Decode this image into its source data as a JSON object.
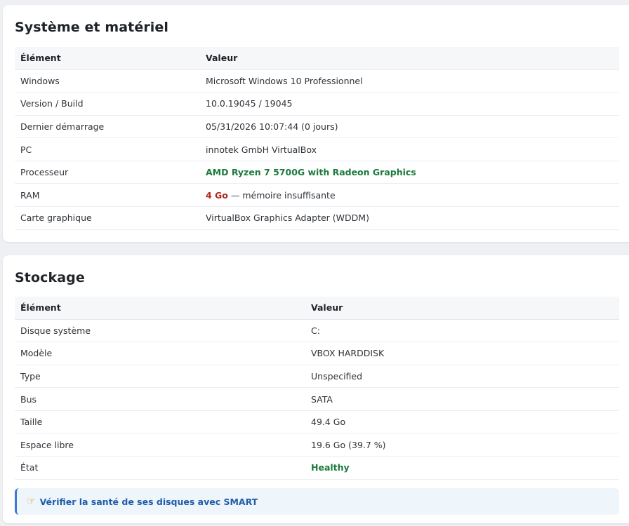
{
  "system": {
    "title": "Système et matériel",
    "headers": [
      "Élément",
      "Valeur"
    ],
    "rows": [
      {
        "label": "Windows",
        "value": "Microsoft Windows 10 Professionnel"
      },
      {
        "label": "Version / Build",
        "value": "10.0.19045 / 19045"
      },
      {
        "label": "Dernier démarrage",
        "value": "05/31/2026 10:07:44 (0 jours)"
      },
      {
        "label": "PC",
        "value": "innotek GmbH VirtualBox"
      },
      {
        "label": "Processeur",
        "value": "AMD Ryzen 7 5700G with Radeon Graphics"
      },
      {
        "label": "RAM",
        "value_bold": "4 Go",
        "value_rest": " — mémoire insuffisante"
      },
      {
        "label": "Carte graphique",
        "value": "VirtualBox Graphics Adapter (WDDM)"
      }
    ]
  },
  "storage": {
    "title": "Stockage",
    "headers": [
      "Élément",
      "Valeur"
    ],
    "rows": [
      {
        "label": "Disque système",
        "value": "C:"
      },
      {
        "label": "Modèle",
        "value": "VBOX HARDDISK"
      },
      {
        "label": "Type",
        "value": "Unspecified"
      },
      {
        "label": "Bus",
        "value": "SATA"
      },
      {
        "label": "Taille",
        "value": "49.4 Go"
      },
      {
        "label": "Espace libre",
        "value": "19.6 Go (39.7 %)"
      },
      {
        "label": "État",
        "value": "Healthy"
      }
    ],
    "tip": {
      "icon": "pointing-hand-icon",
      "label": "Vérifier la santé de ses disques avec SMART"
    }
  },
  "colors": {
    "good": "#1b7a3c",
    "bad": "#b3261e",
    "link": "#1f5da8"
  }
}
